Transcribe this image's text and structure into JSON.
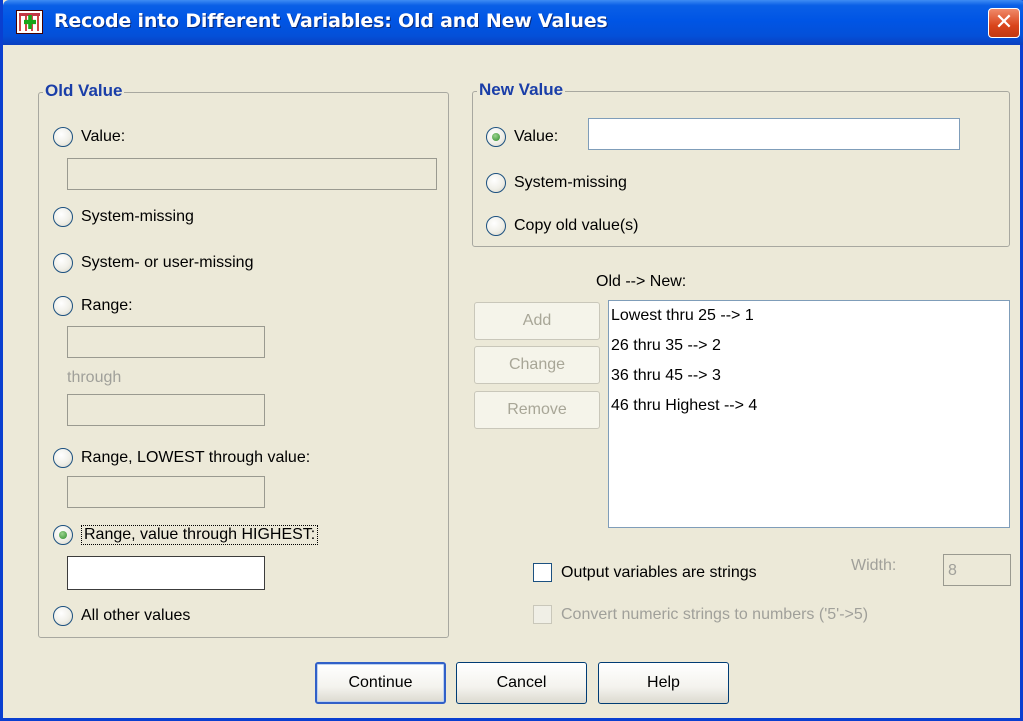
{
  "window": {
    "title": "Recode into Different Variables: Old and New Values",
    "close_glyph": "✕"
  },
  "old_value": {
    "group_title": "Old Value",
    "value_label": "Value:",
    "system_missing_label": "System-missing",
    "system_or_user_missing_label": "System- or user-missing",
    "range_label": "Range:",
    "through_label": "through",
    "range_lowest_label": "Range, LOWEST through value:",
    "range_highest_label": "Range, value through HIGHEST:",
    "range_highest_value": "",
    "all_other_label": "All other values",
    "selected": "range_highest"
  },
  "new_value": {
    "group_title": "New Value",
    "value_label": "Value:",
    "value_input": "",
    "system_missing_label": "System-missing",
    "copy_old_label": "Copy old value(s)",
    "selected": "value"
  },
  "mapping": {
    "header": "Old --> New:",
    "add_label": "Add",
    "change_label": "Change",
    "remove_label": "Remove",
    "items": [
      "Lowest thru 25 --> 1",
      "26 thru 35 --> 2",
      "36 thru 45 --> 3",
      "46 thru Highest --> 4"
    ]
  },
  "options": {
    "output_strings_label": "Output variables are strings",
    "output_strings_checked": false,
    "width_label": "Width:",
    "width_value": "8",
    "convert_label": "Convert numeric strings to numbers ('5'->5)",
    "convert_checked": false
  },
  "footer": {
    "continue_label": "Continue",
    "cancel_label": "Cancel",
    "help_label": "Help"
  },
  "colors": {
    "titlebar": "#0055e5",
    "group_title": "#1a3ea8",
    "dialog_bg": "#ece9d8",
    "close_button": "#d9441a"
  }
}
